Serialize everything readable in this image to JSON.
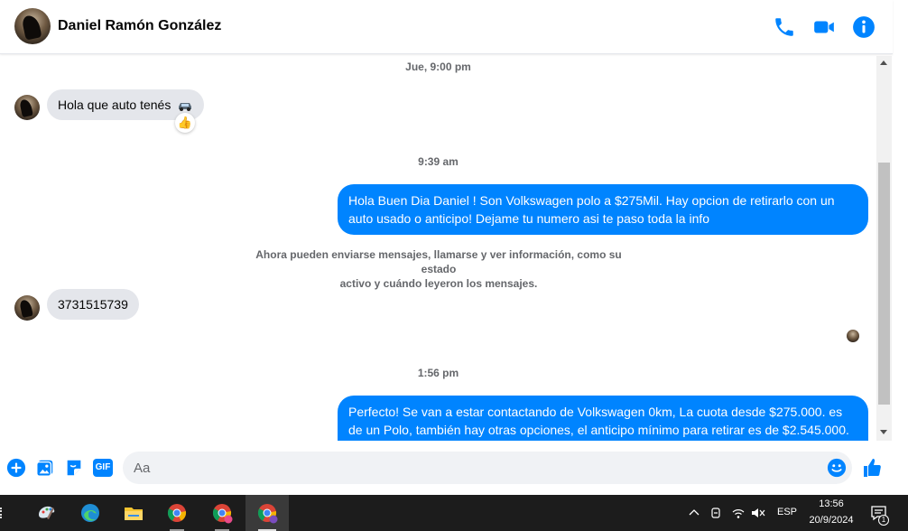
{
  "header": {
    "contact_name": "Daniel Ramón González",
    "icons": [
      "phone-icon",
      "video-call-icon",
      "info-icon"
    ],
    "accent_color": "#0084ff"
  },
  "thread": {
    "ts1": "Jue, 9:00 pm",
    "msg1": "Hola que auto tenés",
    "msg1_emoji": "car-emoji",
    "msg1_reaction": "👍",
    "ts2": "9:39 am",
    "msg2": "Hola Buen Dia Daniel ! Son Volkswagen polo a $275Mil. Hay opcion de retirarlo con un auto usado o anticipo! Dejame tu numero asi te paso toda la info",
    "system_line1": "Ahora pueden enviarse mensajes, llamarse y ver información, como su estado",
    "system_line2": "activo y cuándo leyeron los mensajes.",
    "msg3": "3731515739",
    "ts3": "1:56 pm",
    "msg4": "Perfecto!  Se van a estar contactando de Volkswagen 0km, La cuota desde $275.000. es de un Polo, también hay otras opciones, el anticipo mínimo para retirar es de $2.545.000."
  },
  "composer": {
    "placeholder": "Aa",
    "icons": [
      "add-icon",
      "photo-icon",
      "sticker-icon",
      "gif-icon",
      "emoji-icon",
      "like-icon"
    ],
    "gif_label": "GIF"
  },
  "taskbar": {
    "apps": [
      "paint-icon",
      "edge-icon",
      "file-explorer-icon",
      "chrome-icon",
      "chrome-profile-icon",
      "chrome-incognito-icon"
    ],
    "language": "ESP",
    "time": "13:56",
    "date": "20/9/2024",
    "notification_count": "1"
  }
}
